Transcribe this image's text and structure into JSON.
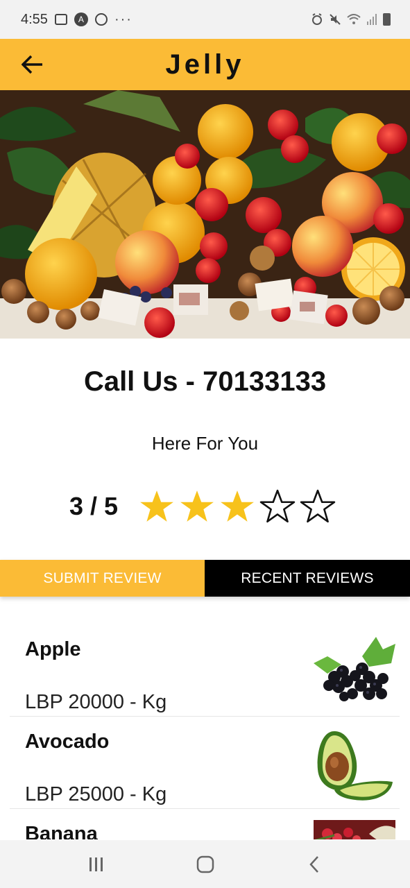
{
  "status_bar": {
    "time": "4:55",
    "dots": "···",
    "left_icons": [
      "gallery-icon",
      "a-badge-icon",
      "whatsapp-icon"
    ],
    "right_icons": [
      "alarm-icon",
      "mute-icon",
      "wifi-icon",
      "signal-icon",
      "battery-icon"
    ]
  },
  "app_bar": {
    "title": "Jelly",
    "back_icon": "arrow-left-icon",
    "background": "#fbbb36"
  },
  "hero": {
    "description": "fruit-assortment-image"
  },
  "info": {
    "phone_line": "Call Us - 70133133",
    "tagline": "Here For You",
    "rating_text": "3 / 5",
    "rating_value": 3,
    "rating_max": 5
  },
  "tabs": {
    "submit_label": "SUBMIT REVIEW",
    "recent_label": "RECENT REVIEWS"
  },
  "products": [
    {
      "name": "Apple",
      "price": "LBP 20000 -  Kg",
      "image": "blackberries-image"
    },
    {
      "name": "Avocado",
      "price": "LBP 25000 -  Kg",
      "image": "avocado-image"
    },
    {
      "name": "Banana",
      "price": "",
      "image": "fruits-image"
    }
  ],
  "nav": {
    "recents_icon": "recents-icon",
    "home_icon": "home-icon",
    "back_icon": "back-chevron-icon"
  },
  "colors": {
    "accent": "#fbbb36",
    "star_fill": "#f7c21b",
    "dark": "#000000"
  }
}
